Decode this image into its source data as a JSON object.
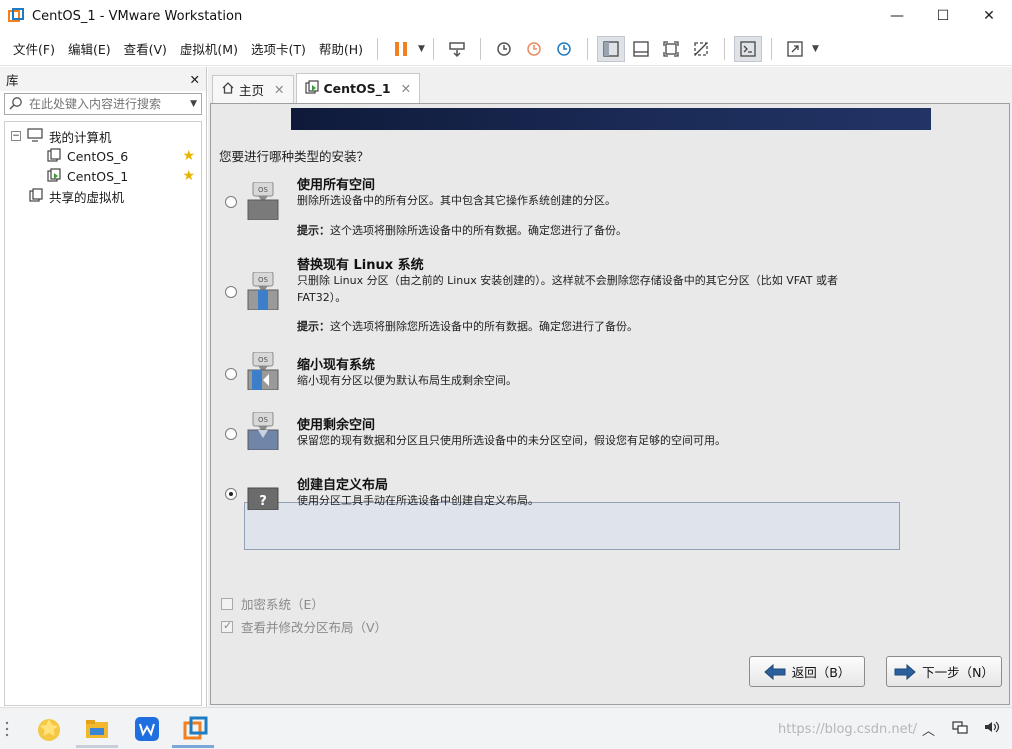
{
  "window": {
    "title": "CentOS_1 - VMware Workstation",
    "minimize": "—",
    "maximize": "☐",
    "close": "✕"
  },
  "menu": {
    "items": [
      "文件(F)",
      "编辑(E)",
      "查看(V)",
      "虚拟机(M)",
      "选项卡(T)",
      "帮助(H)"
    ]
  },
  "library": {
    "title": "库",
    "close": "✕",
    "search_placeholder": "在此处键入内容进行搜索",
    "tree": {
      "root": "我的计算机",
      "vms": [
        "CentOS_6",
        "CentOS_1"
      ],
      "shared": "共享的虚拟机"
    }
  },
  "tabs": {
    "home": "主页",
    "vm": "CentOS_1",
    "close": "✕"
  },
  "installer": {
    "question": "您要进行哪种类型的安装？",
    "options": [
      {
        "title": "使用所有空间",
        "desc": "删除所选设备中的所有分区。其中包含其它操作系统创建的分区。",
        "tip_label": "提示：",
        "tip": "这个选项将删除所选设备中的所有数据。确定您进行了备份。"
      },
      {
        "title": "替换现有 Linux 系统",
        "desc": "只删除 Linux 分区（由之前的 Linux 安装创建的）。这样就不会删除您存储设备中的其它分区（比如 VFAT 或者 FAT32）。",
        "tip_label": "提示：",
        "tip": "这个选项将删除您所选设备中的所有数据。确定您进行了备份。"
      },
      {
        "title": "缩小现有系统",
        "desc": "缩小现有分区以便为默认布局生成剩余空间。"
      },
      {
        "title": "使用剩余空间",
        "desc": "保留您的现有数据和分区且只使用所选设备中的未分区空间，假设您有足够的空间可用。"
      },
      {
        "title": "创建自定义布局",
        "desc": "使用分区工具手动在所选设备中创建自定义布局。"
      }
    ],
    "selected_option": 4,
    "icon_os_label": "OS",
    "icon_question_label": "?",
    "encrypt_label": "加密系统（E）",
    "review_label": "查看并修改分区布局（V）",
    "back_button": "返回（B）",
    "next_button": "下一步（N）"
  },
  "taskbar": {
    "watermark": "https://blog.csdn.net/",
    "tray_up": "︿"
  },
  "colors": {
    "banner": "#1c2c58",
    "selection_bg": "#dfe4ec",
    "accent_orange": "#f08020",
    "vmware_blue": "#1f7bc2"
  }
}
